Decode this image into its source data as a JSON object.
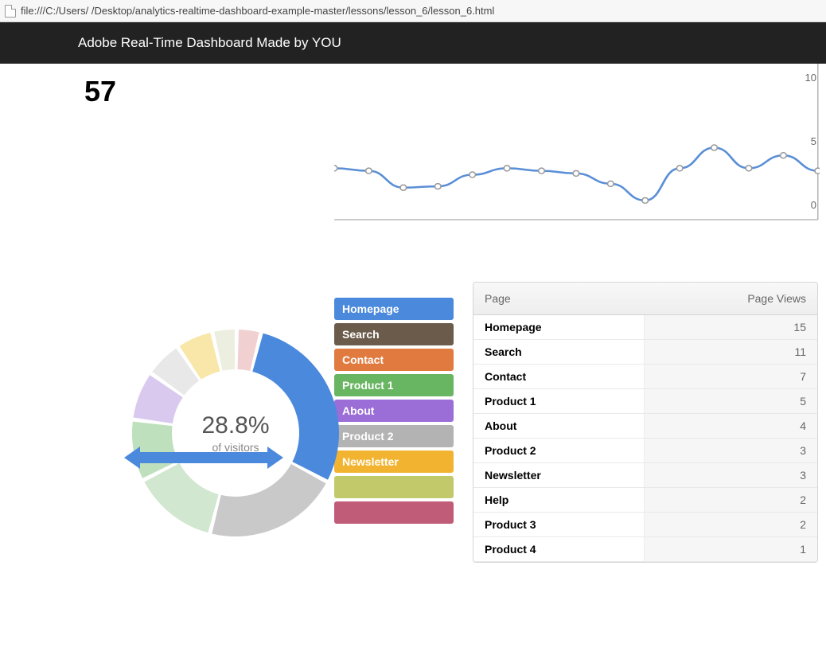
{
  "browser": {
    "url": "file:///C:/Users/        /Desktop/analytics-realtime-dashboard-example-master/lessons/lesson_6/lesson_6.html"
  },
  "header": {
    "title": "Adobe Real-Time Dashboard Made by YOU"
  },
  "counter": {
    "value": "57"
  },
  "donut": {
    "percent": "28.8%",
    "subtitle": "of visitors"
  },
  "legend": {
    "items": [
      {
        "label": "Homepage",
        "color": "#4a89dc"
      },
      {
        "label": "Search",
        "color": "#6b5b4a"
      },
      {
        "label": "Contact",
        "color": "#e07a3f"
      },
      {
        "label": "Product 1",
        "color": "#68b562"
      },
      {
        "label": "About",
        "color": "#9a6dd7"
      },
      {
        "label": "Product 2",
        "color": "#b3b3b3"
      },
      {
        "label": "Newsletter",
        "color": "#f2b430"
      },
      {
        "label": "",
        "color": "#c2c96b"
      },
      {
        "label": "",
        "color": "#c05c78"
      }
    ]
  },
  "table": {
    "headers": {
      "page": "Page",
      "views": "Page Views"
    },
    "rows": [
      {
        "page": "Homepage",
        "views": "15"
      },
      {
        "page": "Search",
        "views": "11"
      },
      {
        "page": "Contact",
        "views": "7"
      },
      {
        "page": "Product 1",
        "views": "5"
      },
      {
        "page": "About",
        "views": "4"
      },
      {
        "page": "Product 2",
        "views": "3"
      },
      {
        "page": "Newsletter",
        "views": "3"
      },
      {
        "page": "Help",
        "views": "2"
      },
      {
        "page": "Product 3",
        "views": "2"
      },
      {
        "page": "Product 4",
        "views": "1"
      }
    ]
  },
  "chart_data": [
    {
      "type": "line",
      "title": "",
      "xlabel": "",
      "ylabel": "",
      "ylim": [
        0,
        10
      ],
      "y_ticks": [
        0,
        5,
        10
      ],
      "x": [
        0,
        1,
        2,
        3,
        4,
        5,
        6,
        7,
        8,
        9,
        10,
        11,
        12,
        13,
        14
      ],
      "values": [
        3.0,
        2.8,
        1.5,
        1.6,
        2.5,
        3.0,
        2.8,
        2.6,
        1.8,
        0.5,
        3.0,
        4.6,
        3.0,
        4.0,
        2.8
      ],
      "series_color": "#5a8fd6"
    },
    {
      "type": "pie",
      "title": "",
      "center_label": "28.8%",
      "center_sub": "of visitors",
      "series": [
        {
          "name": "Homepage",
          "value": 28.8,
          "color": "#4a89dc"
        },
        {
          "name": "Search",
          "value": 21.2,
          "color": "#c9c9c9"
        },
        {
          "name": "Contact",
          "value": 13.5,
          "color": "#d1e7cf"
        },
        {
          "name": "Product 1",
          "value": 9.6,
          "color": "#bfe0bc"
        },
        {
          "name": "About",
          "value": 7.7,
          "color": "#d9c9ef"
        },
        {
          "name": "Product 2",
          "value": 5.8,
          "color": "#e8e8e8"
        },
        {
          "name": "Newsletter",
          "value": 5.8,
          "color": "#f9e6a9"
        },
        {
          "name": "Help",
          "value": 3.8,
          "color": "#ecefe0"
        },
        {
          "name": "Product 3",
          "value": 3.8,
          "color": "#f0d0d0"
        }
      ]
    }
  ]
}
